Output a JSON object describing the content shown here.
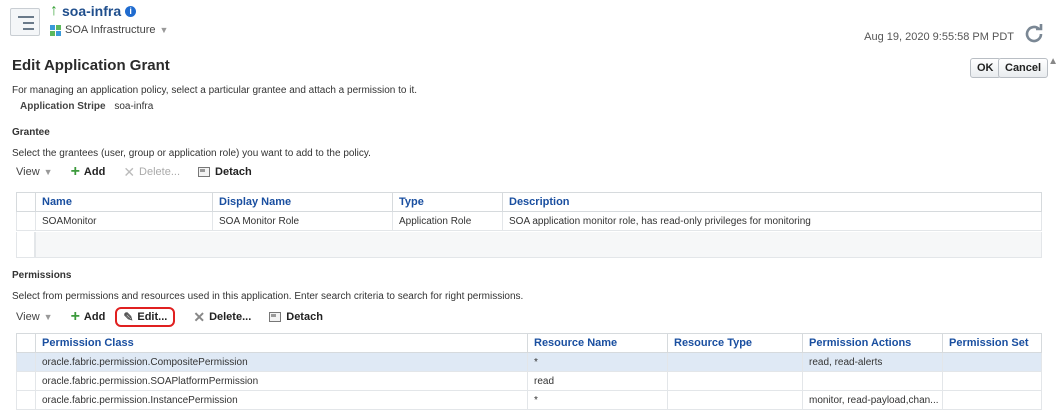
{
  "header": {
    "app_title": "soa-infra",
    "info_glyph": "i",
    "subtitle": "SOA Infrastructure",
    "timestamp": "Aug 19, 2020 9:55:58 PM PDT",
    "icons": {
      "nav": "navigator-icon",
      "up": "up-arrow-icon",
      "info": "info-icon",
      "target": "soa-infrastructure-icon",
      "refresh": "refresh-icon"
    }
  },
  "page": {
    "title": "Edit Application Grant",
    "ok_label": "OK",
    "cancel_label": "Cancel",
    "description": "For managing an application policy, select a particular grantee and attach a permission to it.",
    "stripe_label": "Application Stripe",
    "stripe_value": "soa-infra"
  },
  "grantee": {
    "heading": "Grantee",
    "description": "Select the grantees (user, group or application role) you want to add to the policy.",
    "toolbar": {
      "view": "View",
      "add": "Add",
      "delete": "Delete...",
      "detach": "Detach"
    },
    "columns": [
      "Name",
      "Display Name",
      "Type",
      "Description"
    ],
    "rows": [
      [
        "SOAMonitor",
        "SOA Monitor Role",
        "Application Role",
        "SOA application monitor role, has read-only privileges for monitoring"
      ]
    ]
  },
  "permissions": {
    "heading": "Permissions",
    "description": "Select from permissions and resources used in this application. Enter search criteria to search for right permissions.",
    "toolbar": {
      "view": "View",
      "add": "Add",
      "edit": "Edit...",
      "delete": "Delete...",
      "detach": "Detach"
    },
    "columns": [
      "Permission Class",
      "Resource Name",
      "Resource Type",
      "Permission Actions",
      "Permission Set"
    ],
    "rows": [
      [
        "oracle.fabric.permission.CompositePermission",
        "*",
        "",
        "read, read-alerts",
        ""
      ],
      [
        "oracle.fabric.permission.SOAPlatformPermission",
        "read",
        "",
        "",
        ""
      ],
      [
        "oracle.fabric.permission.InstancePermission",
        "*",
        "",
        "monitor, read-payload,chan...",
        ""
      ]
    ]
  },
  "colors": {
    "accent": "#1a4fa0",
    "selected_row": "#dfe9f5",
    "highlight": "#e02020",
    "add_green": "#3c9a3c"
  }
}
